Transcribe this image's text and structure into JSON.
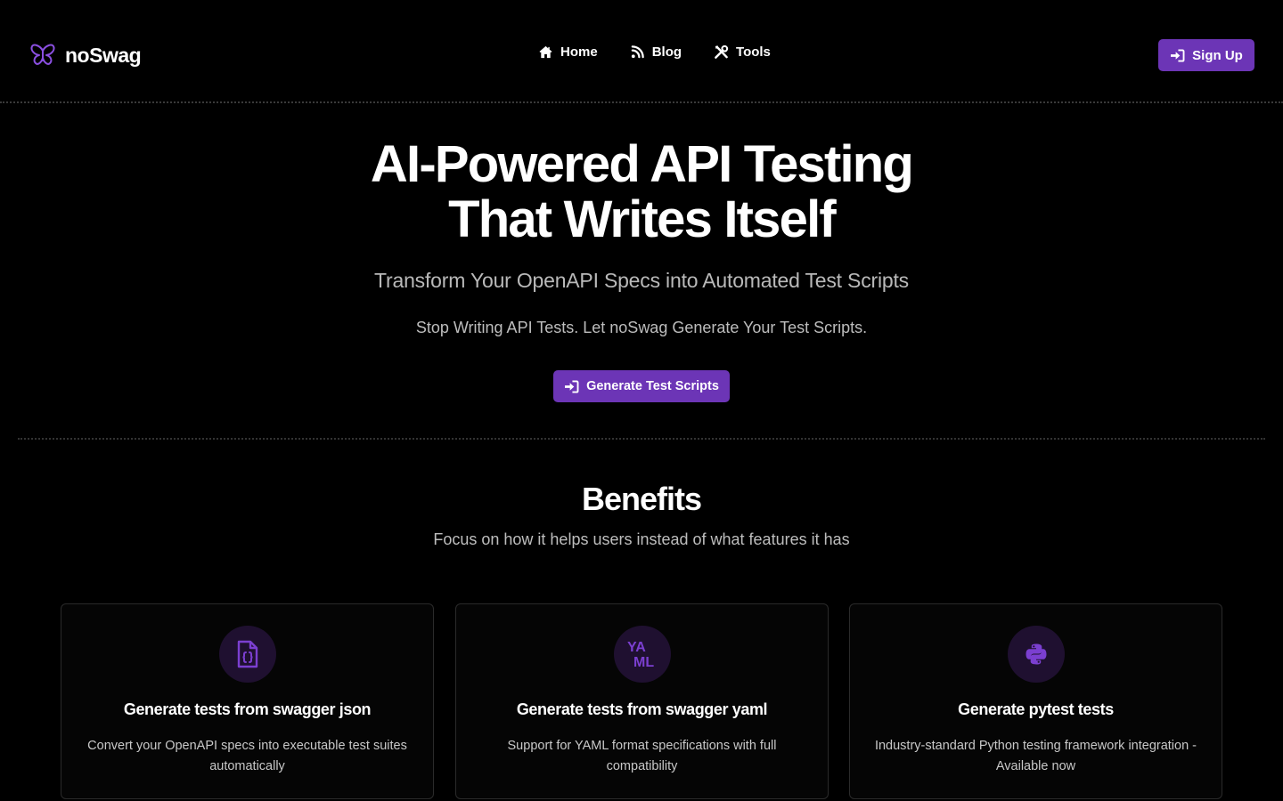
{
  "header": {
    "logo_text": "noSwag",
    "logo_icon": "butterfly-icon",
    "nav": [
      {
        "label": "Home",
        "icon": "home-icon"
      },
      {
        "label": "Blog",
        "icon": "rss-icon"
      },
      {
        "label": "Tools",
        "icon": "tools-icon"
      }
    ],
    "signup_label": "Sign Up"
  },
  "hero": {
    "title_line1": "AI-Powered API Testing",
    "title_line2": "That Writes Itself",
    "subtitle": "Transform Your OpenAPI Specs into Automated Test Scripts",
    "description": "Stop Writing API Tests. Let noSwag Generate Your Test Scripts.",
    "cta_label": "Generate Test Scripts"
  },
  "benefits": {
    "title": "Benefits",
    "subtitle": "Focus on how it helps users instead of what features it has",
    "cards": [
      {
        "icon": "json-file-icon",
        "title": "Generate tests from swagger json",
        "text": "Convert your OpenAPI specs into executable test suites automatically"
      },
      {
        "icon": "yaml-icon",
        "icon_text_top": "YA",
        "icon_text_bottom": "ML",
        "title": "Generate tests from swagger yaml",
        "text": "Support for YAML format specifications with full compatibility"
      },
      {
        "icon": "python-icon",
        "title": "Generate pytest tests",
        "text": "Industry-standard Python testing framework integration - Available now"
      }
    ]
  },
  "colors": {
    "accent": "#6c35b6",
    "icon_purple": "#7b3fd0",
    "background": "#000000"
  }
}
